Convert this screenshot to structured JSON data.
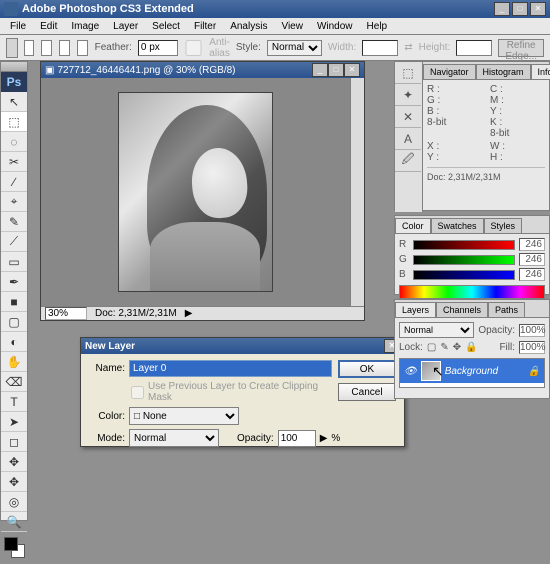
{
  "app": {
    "title": "Adobe Photoshop CS3 Extended"
  },
  "menu": [
    "File",
    "Edit",
    "Image",
    "Layer",
    "Select",
    "Filter",
    "Analysis",
    "View",
    "Window",
    "Help"
  ],
  "options": {
    "feather_label": "Feather:",
    "feather_value": "0 px",
    "antialias": "Anti-alias",
    "style_label": "Style:",
    "style_value": "Normal",
    "width_label": "Width:",
    "height_label": "Height:",
    "refine": "Refine Edge..."
  },
  "tools": [
    "↖",
    "⬚",
    "◌",
    "✂",
    "∕",
    "⌖",
    "✎",
    "⟋",
    "▭",
    "✒",
    "■",
    "▢",
    "◐",
    "✋",
    "⌫",
    "T",
    "➤",
    "◻",
    "✥",
    "✥",
    "◎",
    "🔍"
  ],
  "document": {
    "title": "727712_46446441.png @ 30% (RGB/8)",
    "zoom": "30%",
    "status": "Doc: 2,31M/2,31M"
  },
  "dialog": {
    "title": "New Layer",
    "name_label": "Name:",
    "name_value": "Layer 0",
    "clip_label": "Use Previous Layer to Create Clipping Mask",
    "color_label": "Color:",
    "color_value": "None",
    "mode_label": "Mode:",
    "mode_value": "Normal",
    "opacity_label": "Opacity:",
    "opacity_value": "100",
    "opacity_pct": "%",
    "ok": "OK",
    "cancel": "Cancel"
  },
  "panels": {
    "nav_tabs": [
      "Navigator",
      "Histogram",
      "Info"
    ],
    "info": {
      "r": "R :",
      "g": "G :",
      "b": "B :",
      "bk1": "8-bit",
      "c": "C :",
      "m": "M :",
      "y": "Y :",
      "k": "K :",
      "bk2": "8-bit",
      "x": "X :",
      "yc": "Y :",
      "w": "W :",
      "h": "H :",
      "doc": "Doc: 2,31M/2,31M"
    },
    "color_tabs": [
      "Color",
      "Swatches",
      "Styles"
    ],
    "color": {
      "r": "R",
      "g": "G",
      "b": "B",
      "val": "246"
    },
    "layer_tabs": [
      "Layers",
      "Channels",
      "Paths"
    ],
    "layers": {
      "blend": "Normal",
      "opacity_label": "Opacity:",
      "opacity": "100%",
      "lock_label": "Lock:",
      "fill_label": "Fill:",
      "fill": "100%",
      "item": "Background"
    }
  }
}
